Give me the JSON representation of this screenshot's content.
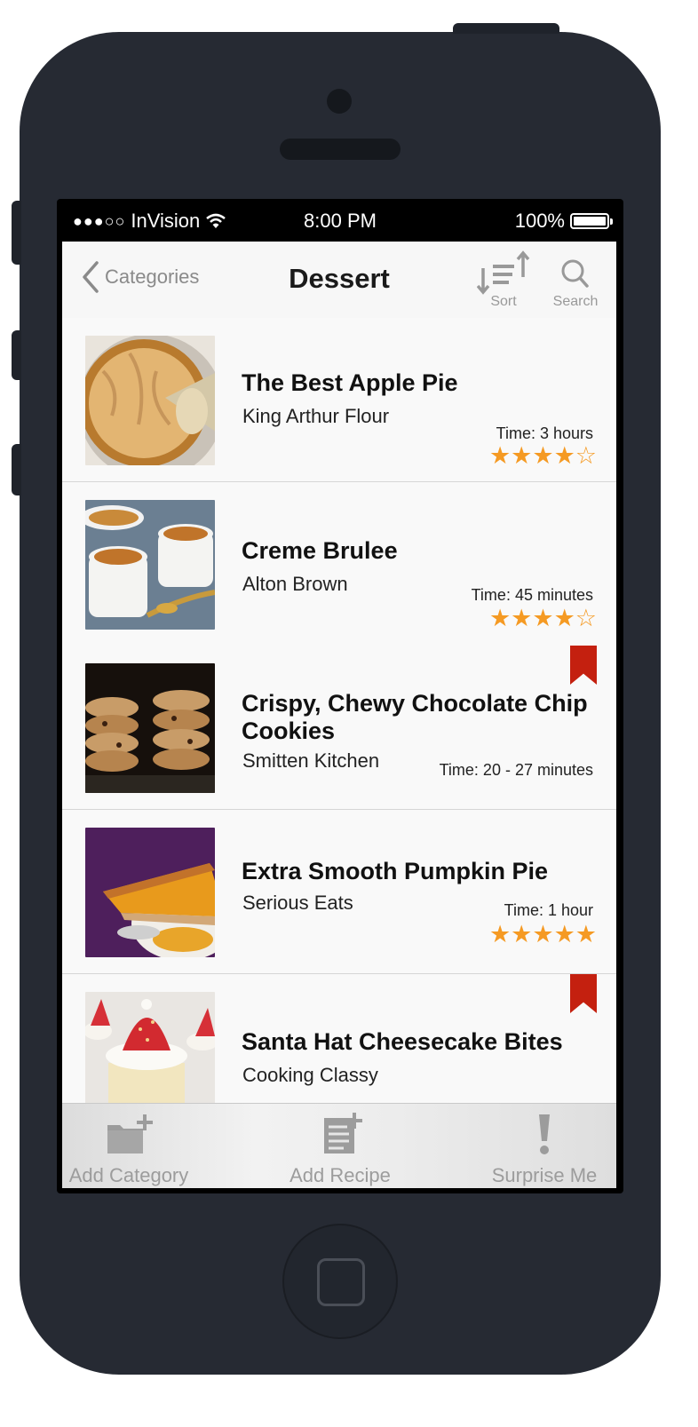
{
  "status_bar": {
    "carrier": "InVision",
    "signal_dots": "●●●○○",
    "time": "8:00 PM",
    "battery": "100%"
  },
  "nav": {
    "back_label": "Categories",
    "title": "Dessert",
    "sort_label": "Sort",
    "search_label": "Search"
  },
  "recipes": [
    {
      "title": "The Best Apple Pie",
      "author": "King Arthur Flour",
      "time": "Time: 3 hours",
      "rating": 4,
      "stars": "★★★★☆",
      "bookmarked": false
    },
    {
      "title": "Creme Brulee",
      "author": "Alton Brown",
      "time": "Time: 45 minutes",
      "rating": 4,
      "stars": "★★★★☆",
      "bookmarked": false
    },
    {
      "title_line1": "Crispy, Chewy Chocolate Chip",
      "title_line2": "Cookies",
      "author": "Smitten Kitchen",
      "time": "Time: 20 - 27 minutes",
      "bookmarked": true
    },
    {
      "title": "Extra Smooth Pumpkin Pie",
      "author": "Serious Eats",
      "time": "Time: 1 hour",
      "rating": 5,
      "stars": "★★★★★",
      "bookmarked": false
    },
    {
      "title": "Santa Hat Cheesecake Bites",
      "author": "Cooking Classy",
      "bookmarked": true
    }
  ],
  "tab_bar": {
    "add_category": "Add Category",
    "add_recipe": "Add Recipe",
    "surprise_me": "Surprise Me"
  },
  "colors": {
    "star": "#f59a23",
    "bookmark": "#c4200f",
    "phone_body": "#262a33"
  }
}
